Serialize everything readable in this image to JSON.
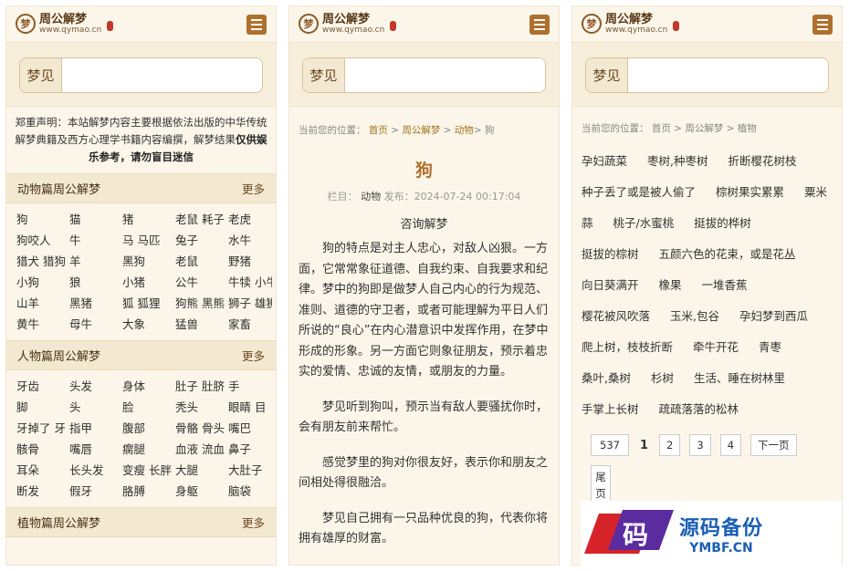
{
  "site": {
    "title": "周公解梦",
    "url": "www.qymao.cn",
    "logo_glyph": "梦"
  },
  "search": {
    "label": "梦见",
    "placeholder": ""
  },
  "panel1": {
    "notice_normal": "郑重声明：本站解梦内容主要根据依法出版的中华传统解梦典籍及西方心理学书籍内容编撰，解梦结果",
    "notice_bold": "仅供娱乐参考，请勿盲目迷信",
    "sections": [
      {
        "title": "动物篇周公解梦",
        "more": "更多",
        "items": [
          "狗",
          "猫",
          "猪",
          "老鼠 耗子",
          "老虎",
          "狗咬人",
          "牛",
          "马 马匹",
          "兔子",
          "水牛",
          "猎犬 猎狗",
          "羊",
          "黑狗",
          "老鼠",
          "野猪",
          "小狗",
          "狼",
          "小猪",
          "公牛",
          "牛犊 小牛",
          "山羊",
          "黑猪",
          "狐 狐狸",
          "狗熊 黑熊",
          "狮子 雄狮",
          "黄牛",
          "母牛",
          "大象",
          "猛兽",
          "家畜"
        ]
      },
      {
        "title": "人物篇周公解梦",
        "more": "更多",
        "items": [
          "牙齿",
          "头发",
          "身体",
          "肚子 肚脐",
          "手",
          "脚",
          "头",
          "脸",
          "秃头",
          "眼睛 目",
          "牙掉了 牙",
          "指甲",
          "腹部",
          "骨骼 骨头",
          "嘴巴",
          "骸骨",
          "嘴唇",
          "瘸腿",
          "血液 流血",
          "鼻子",
          "耳朵",
          "长头发",
          "变瘦 长胖",
          "大腿",
          "大肚子",
          "断发",
          "假牙",
          "胳膊",
          "身躯",
          "脑袋"
        ]
      },
      {
        "title": "植物篇周公解梦",
        "more": "更多"
      }
    ]
  },
  "panel2": {
    "crumb_prefix": "当前您的位置：",
    "crumb_home": "首页",
    "crumb_site": "周公解梦",
    "crumb_cat": "动物",
    "crumb_page": "狗",
    "title": "狗",
    "meta_prefix": "栏目：",
    "meta_cat": "动物",
    "meta_date": "发布：2024-07-24 00:17:04",
    "subtitle": "咨询解梦",
    "paragraphs": [
      "狗的特点是对主人忠心，对敌人凶狠。一方面，它常常象征道德、自我约束、自我要求和纪律。梦中的狗即是做梦人自己内心的行为规范、准则、道德的守卫者，或者可能理解为平日人们所说的“良心”在内心潜意识中发挥作用，在梦中形成的形象。另一方面它则象征朋友，预示着忠实的爱情、忠诚的友情，或朋友的力量。",
      "梦见听到狗叫，预示当有敌人要骚扰你时，会有朋友前来帮忙。",
      "感觉梦里的狗对你很友好，表示你和朋友之间相处得很融洽。",
      "梦见自己拥有一只品种优良的狗，代表你将拥有雄厚的财富。"
    ]
  },
  "panel3": {
    "crumb_prefix": "当前您的位置：",
    "crumb_home": "首页",
    "crumb_site": "周公解梦",
    "crumb_cat": "植物",
    "rows": [
      [
        "孕妇蔬菜",
        "枣树,种枣树",
        "折断樱花树枝"
      ],
      [
        "种子丢了或是被人偷了",
        "棕树果实累累",
        "粟米"
      ],
      [
        "蒜",
        "桃子/水蜜桃",
        "挺拔的桦树"
      ],
      [
        "挺拔的棕树",
        "五颜六色的花束，或是花丛"
      ],
      [
        "向日葵满开",
        "橡果",
        "一堆香蕉"
      ],
      [
        "樱花被风吹落",
        "玉米,包谷",
        "孕妇梦到西瓜"
      ],
      [
        "爬上树，枝枝折断",
        "牵牛开花",
        "青枣"
      ],
      [
        "桑叶,桑树",
        "杉树",
        "生活、睡在树林里"
      ],
      [
        "手掌上长树",
        "疏疏落落的松林"
      ]
    ],
    "pager": {
      "total": "537",
      "current": "1",
      "pages": [
        "2",
        "3",
        "4"
      ],
      "next": "下一页",
      "last": "尾页"
    }
  },
  "watermark": {
    "glyph": "码",
    "cn": "源码备份",
    "en": "YMBF.CN"
  }
}
